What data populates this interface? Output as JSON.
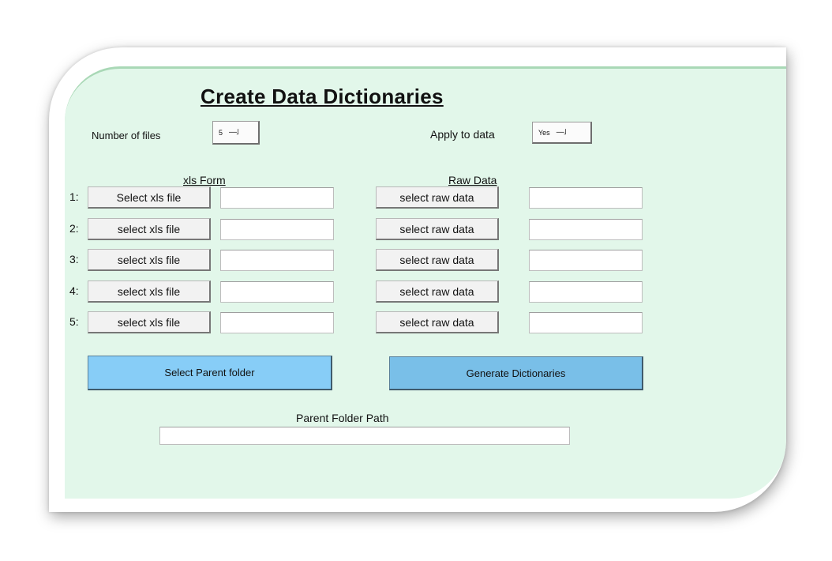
{
  "title": "Create Data Dictionaries",
  "number_of_files": {
    "label": "Number of files",
    "value": "5"
  },
  "apply_to_data": {
    "label": "Apply to data",
    "value": "Yes"
  },
  "columns": {
    "xls": "xls Form",
    "raw": "Raw Data"
  },
  "rows": [
    {
      "num": "1:",
      "xls_button": "Select xls file",
      "raw_button": "select raw data",
      "xls_path": "",
      "raw_path": ""
    },
    {
      "num": "2:",
      "xls_button": "select xls file",
      "raw_button": "select raw data",
      "xls_path": "",
      "raw_path": ""
    },
    {
      "num": "3:",
      "xls_button": "select xls file",
      "raw_button": "select raw data",
      "xls_path": "",
      "raw_path": ""
    },
    {
      "num": "4:",
      "xls_button": "select xls file",
      "raw_button": "select raw data",
      "xls_path": "",
      "raw_path": ""
    },
    {
      "num": "5:",
      "xls_button": "select xls file",
      "raw_button": "select raw data",
      "xls_path": "",
      "raw_path": ""
    }
  ],
  "actions": {
    "select_parent": "Select Parent folder",
    "generate": "Generate Dictionaries"
  },
  "parent_folder": {
    "label": "Parent Folder Path",
    "value": ""
  },
  "colors": {
    "panel_bg": "#e2f7ea",
    "select_parent_bg": "#87cdf7",
    "generate_bg": "#79bfe8"
  },
  "icons": {
    "dropdown": "dropdown-arrow-icon"
  }
}
